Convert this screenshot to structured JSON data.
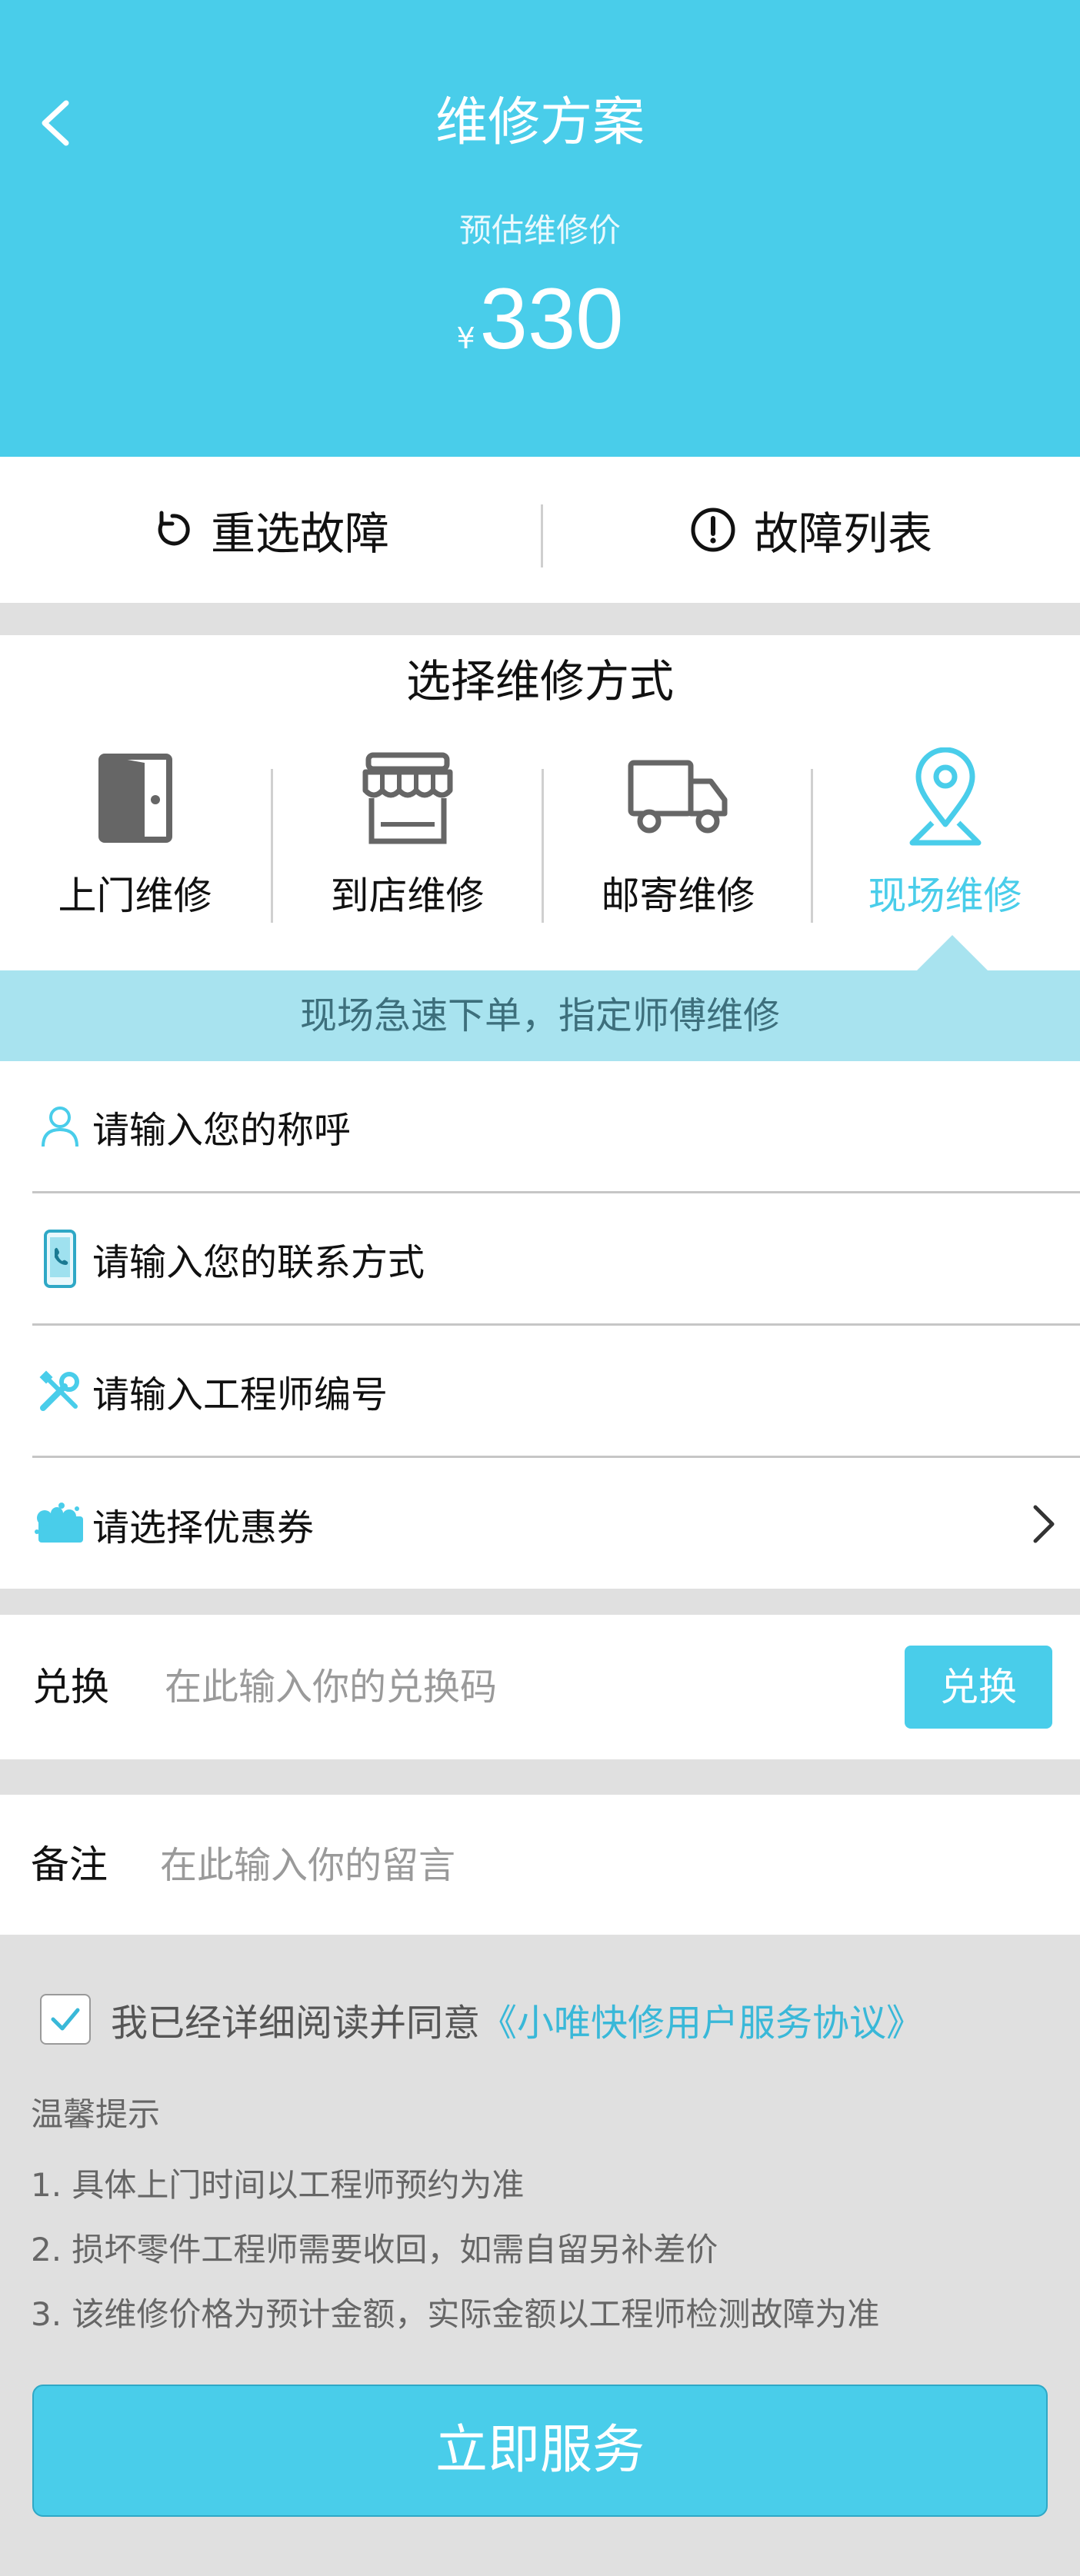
{
  "header": {
    "title": "维修方案",
    "price_label": "预估维修价",
    "currency": "¥",
    "price": "330",
    "bg_color": "#49cdea"
  },
  "actions": {
    "reselect_label": "重选故障",
    "fault_list_label": "故障列表",
    "reselect_icon": "refresh-icon",
    "fault_list_icon": "alert-circle-icon"
  },
  "method": {
    "title": "选择维修方式",
    "options": [
      {
        "label": "上门维修",
        "icon": "door-icon"
      },
      {
        "label": "到店维修",
        "icon": "store-icon"
      },
      {
        "label": "邮寄维修",
        "icon": "truck-icon"
      },
      {
        "label": "现场维修",
        "icon": "location-pin-icon"
      }
    ],
    "selected": "现场维修",
    "hint": "现场急速下单，指定师傅维修"
  },
  "form": {
    "name_placeholder": "请输入您的称呼",
    "contact_placeholder": "请输入您的联系方式",
    "engineer_placeholder": "请输入工程师编号",
    "coupon_label": "请选择优惠券"
  },
  "exchange": {
    "label": "兑换",
    "placeholder": "在此输入你的兑换码",
    "button": "兑换"
  },
  "remark": {
    "label": "备注",
    "placeholder": "在此输入你的留言"
  },
  "agreement": {
    "checked": true,
    "text": "我已经详细阅读并同意",
    "link": "《小唯快修用户服务协议》"
  },
  "tips": {
    "title": "温馨提示",
    "items": [
      "1. 具体上门时间以工程师预约为准",
      "2. 损坏零件工程师需要收回，如需自留另补差价",
      "3. 该维修价格为预计金额，实际金额以工程师检测故障为准"
    ]
  },
  "submit": {
    "label": "立即服务"
  },
  "colors": {
    "accent": "#49cdea",
    "hint_bg": "#a8e3ef",
    "link": "#39b8d8"
  }
}
